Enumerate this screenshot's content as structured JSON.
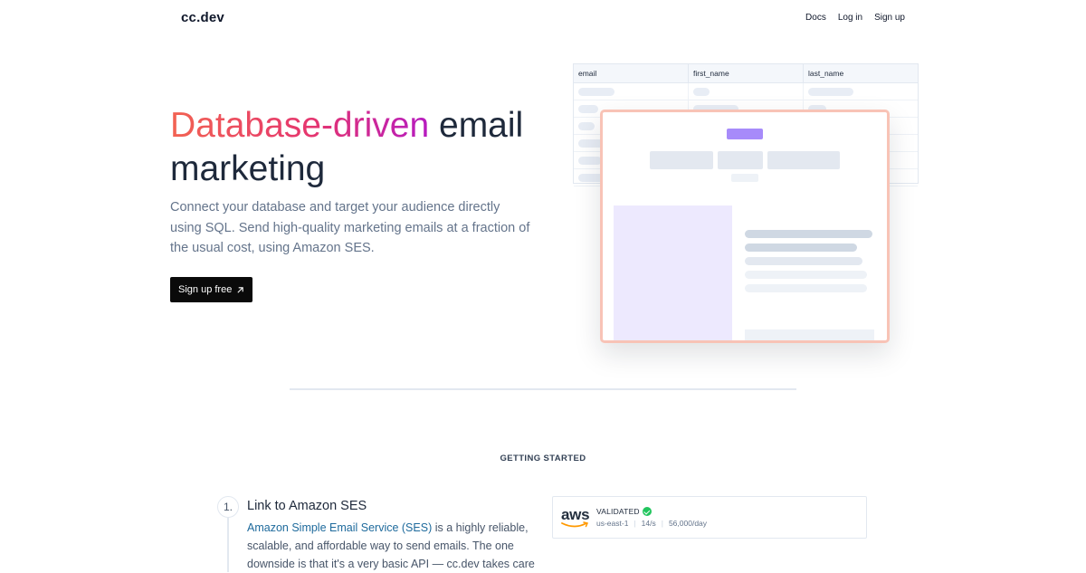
{
  "nav": {
    "logo": "cc.dev",
    "links": [
      "Docs",
      "Log in",
      "Sign up"
    ]
  },
  "hero": {
    "title_highlight": "Database-driven",
    "title_rest": " email marketing",
    "description": "Connect your database and target your audience directly using SQL. Send high-quality marketing emails at a fraction of the usual cost, using Amazon SES.",
    "cta_label": "Sign up free",
    "cta_icon": "arrow-up-right-icon"
  },
  "db_table": {
    "columns": [
      "email",
      "first_name",
      "last_name"
    ]
  },
  "colors": {
    "gradient": [
      "#f26352",
      "#e5356f",
      "#b61bc0"
    ],
    "card_border": "#f8c3b6",
    "badge": "#a78bfa",
    "validated": "#22c55e"
  },
  "getting_started": {
    "label": "GETTING STARTED",
    "step": {
      "number": "1.",
      "title": "Link to Amazon SES",
      "link_text": "Amazon Simple Email Service (SES)",
      "desc_rest": " is a highly reliable, scalable, and affordable way to send emails. The one downside is that it's a very basic API — cc.dev takes care"
    },
    "ses_card": {
      "logo": "aws",
      "status": "VALIDATED",
      "region": "us-east-1",
      "rate": "14/s",
      "quota": "56,000/day"
    }
  }
}
